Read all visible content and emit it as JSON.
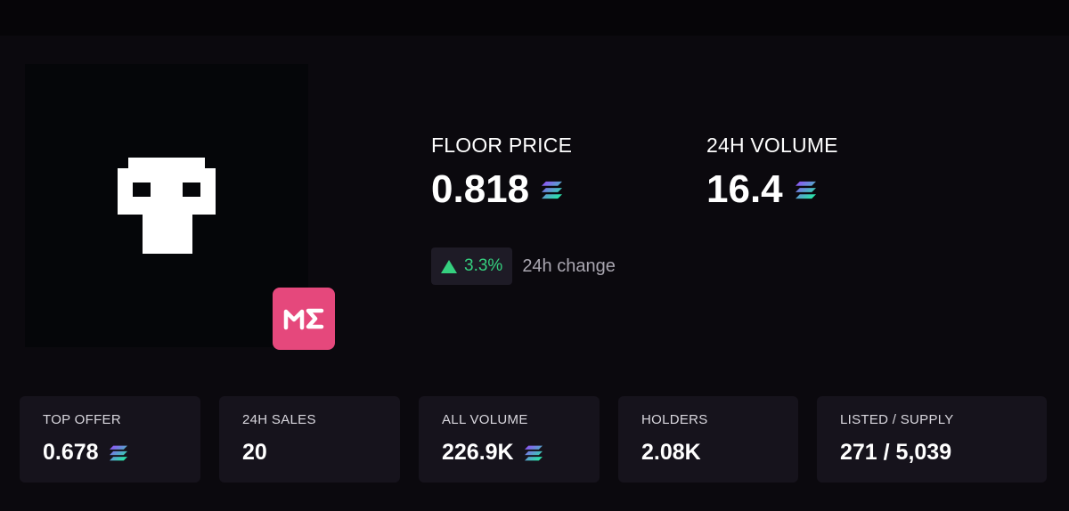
{
  "collection": {
    "image_icon": "pixel-skull-icon",
    "marketplace_badge": {
      "icon": "magic-eden-logo",
      "color": "#e5487c"
    }
  },
  "floor_price": {
    "label": "FLOOR PRICE",
    "value": "0.818",
    "currency_icon": "solana-icon"
  },
  "volume_24h": {
    "label": "24H VOLUME",
    "value": "16.4",
    "currency_icon": "solana-icon"
  },
  "change": {
    "value": "3.3%",
    "direction": "up",
    "label": "24h change",
    "color": "#35d07f"
  },
  "cards": [
    {
      "label": "TOP OFFER",
      "value": "0.678",
      "currency_icon": "solana-icon"
    },
    {
      "label": "24H SALES",
      "value": "20"
    },
    {
      "label": "ALL VOLUME",
      "value": "226.9K",
      "currency_icon": "solana-icon"
    },
    {
      "label": "HOLDERS",
      "value": "2.08K"
    },
    {
      "label": "LISTED / SUPPLY",
      "value": "271 / 5,039"
    }
  ]
}
